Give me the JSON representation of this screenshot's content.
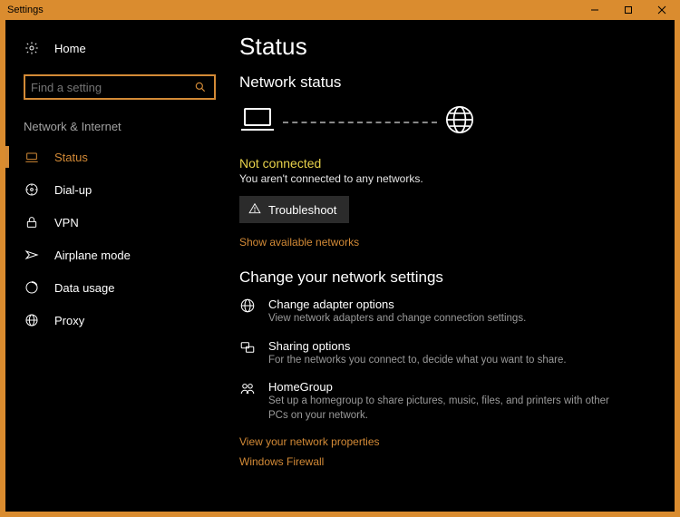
{
  "window": {
    "title": "Settings"
  },
  "sidebar": {
    "home_label": "Home",
    "search_placeholder": "Find a setting",
    "category_label": "Network & Internet",
    "items": [
      {
        "label": "Status"
      },
      {
        "label": "Dial-up"
      },
      {
        "label": "VPN"
      },
      {
        "label": "Airplane mode"
      },
      {
        "label": "Data usage"
      },
      {
        "label": "Proxy"
      }
    ]
  },
  "main": {
    "page_title": "Status",
    "section_title": "Network status",
    "status_heading": "Not connected",
    "status_sub": "You aren't connected to any networks.",
    "troubleshoot_label": "Troubleshoot",
    "show_networks_link": "Show available networks",
    "change_header": "Change your network settings",
    "options": [
      {
        "label": "Change adapter options",
        "desc": "View network adapters and change connection settings."
      },
      {
        "label": "Sharing options",
        "desc": "For the networks you connect to, decide what you want to share."
      },
      {
        "label": "HomeGroup",
        "desc": "Set up a homegroup to share pictures, music, files, and printers with other PCs on your network."
      }
    ],
    "view_props_link": "View your network properties",
    "firewall_link": "Windows Firewall"
  }
}
